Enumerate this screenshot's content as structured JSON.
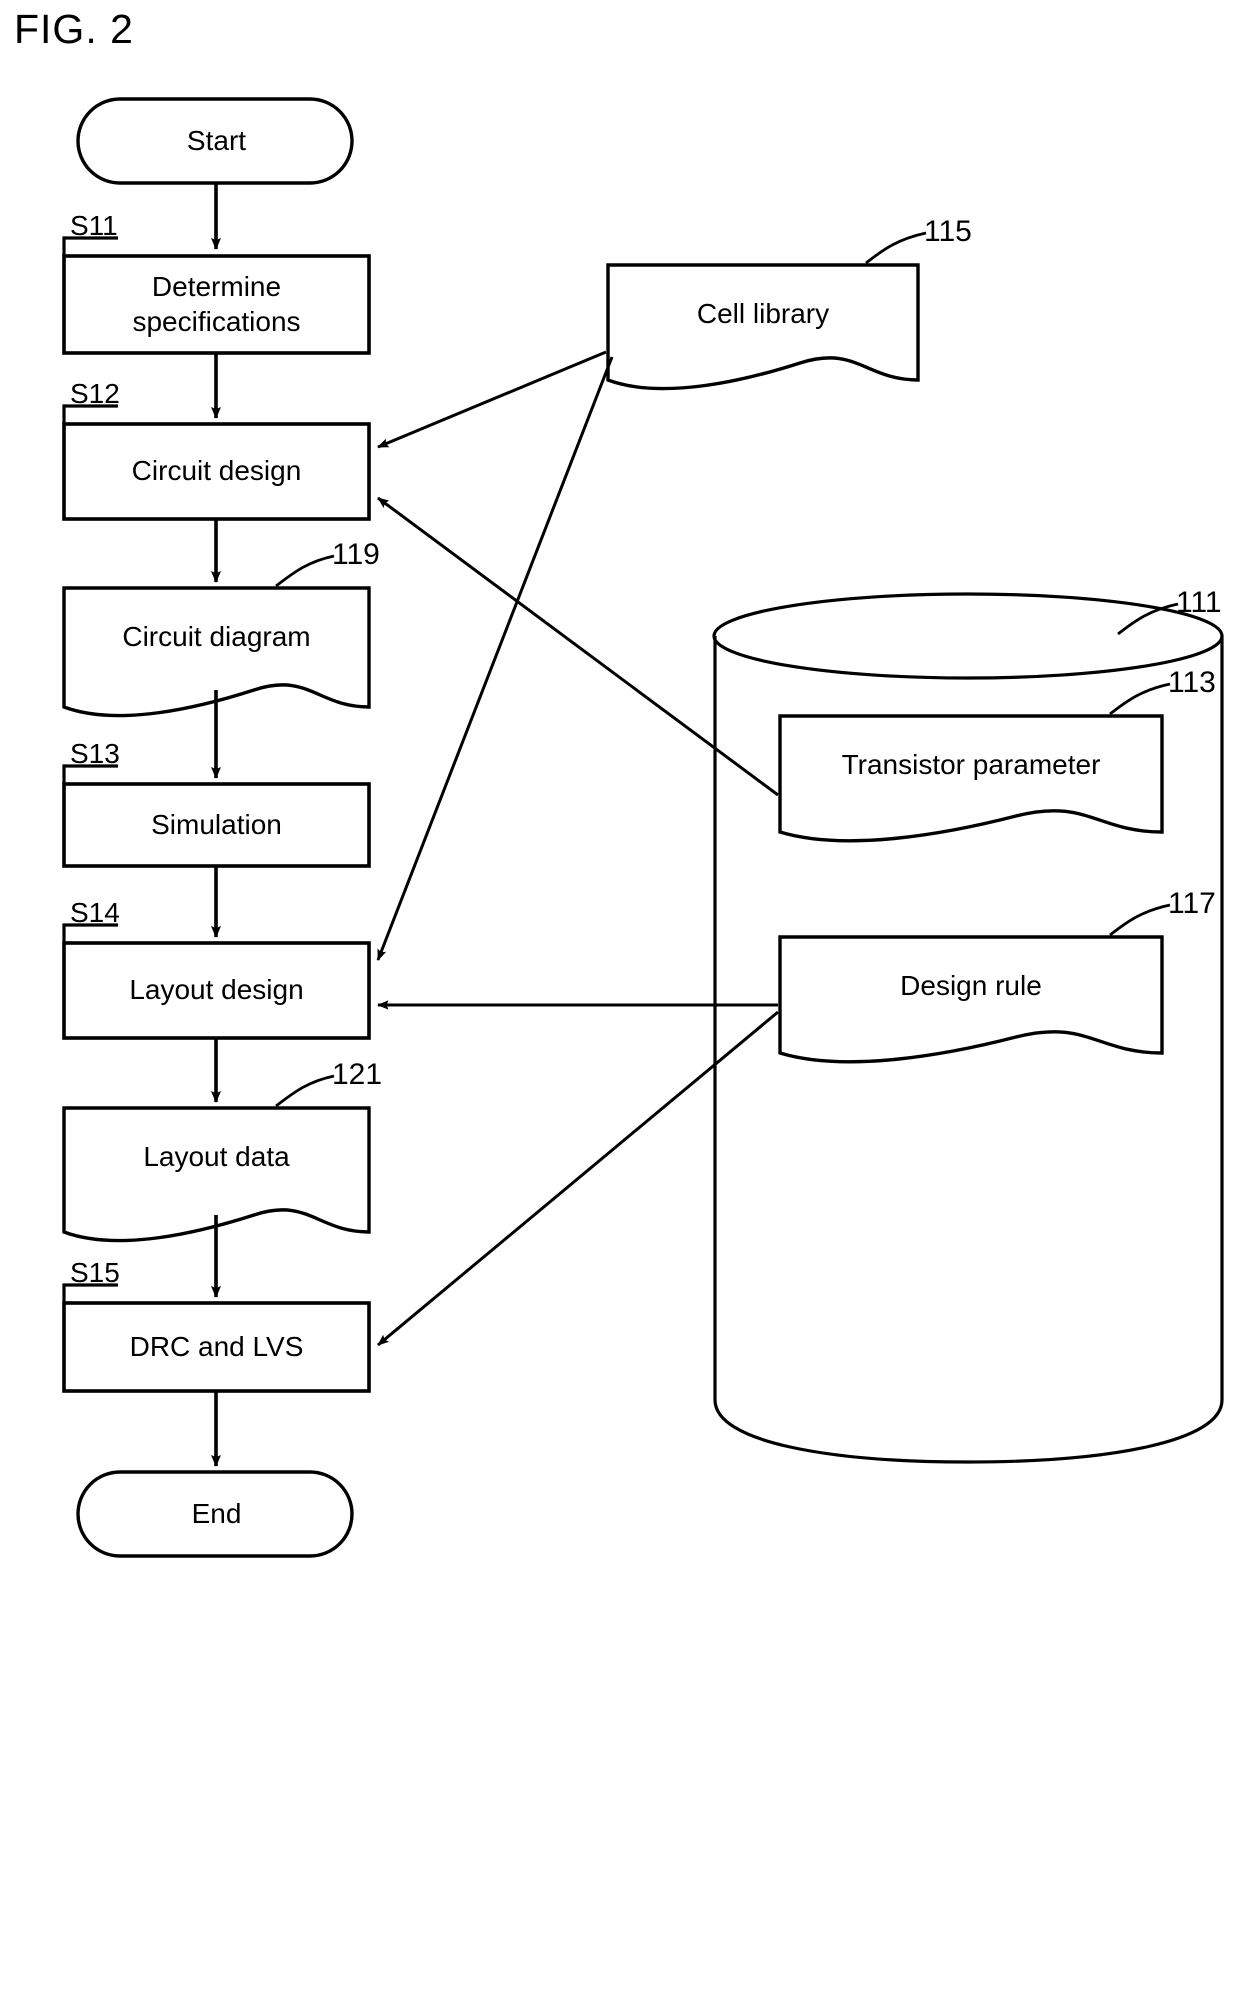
{
  "figure": {
    "label": "FIG. 2",
    "kind": "flowchart",
    "line_color": "#000000",
    "background_color": "#ffffff"
  },
  "flow": {
    "start_terminal": {
      "label": "Start",
      "shape": "stadium"
    },
    "end_terminal": {
      "label": "End",
      "shape": "stadium"
    },
    "steps": [
      {
        "tag": "S11",
        "label": "Determine\nspecifications",
        "shape": "process"
      },
      {
        "tag": "S12",
        "label": "Circuit design",
        "shape": "process"
      },
      {
        "tag": "S13",
        "label": "Simulation",
        "shape": "process"
      },
      {
        "tag": "S14",
        "label": "Layout design",
        "shape": "process"
      },
      {
        "tag": "S15",
        "label": "DRC and LVS",
        "shape": "process"
      }
    ],
    "documents": [
      {
        "ref": "119",
        "label": "Circuit diagram",
        "shape": "document"
      },
      {
        "ref": "121",
        "label": "Layout data",
        "shape": "document"
      }
    ]
  },
  "resources": {
    "cell_library": {
      "ref": "115",
      "label": "Cell library",
      "shape": "document"
    },
    "database": {
      "ref": "111",
      "label": "",
      "shape": "cylinder"
    },
    "transistor_parameter": {
      "ref": "113",
      "label": "Transistor parameter",
      "shape": "document"
    },
    "design_rule": {
      "ref": "117",
      "label": "Design rule",
      "shape": "document"
    }
  },
  "connections": [
    {
      "from": "Start",
      "to": "S11",
      "type": "arrow-down"
    },
    {
      "from": "S11",
      "to": "S12",
      "type": "arrow-down"
    },
    {
      "from": "S12",
      "to": "119",
      "type": "arrow-down"
    },
    {
      "from": "119",
      "to": "S13",
      "type": "arrow-down"
    },
    {
      "from": "S13",
      "to": "S14",
      "type": "arrow-down"
    },
    {
      "from": "S14",
      "to": "121",
      "type": "arrow-down"
    },
    {
      "from": "121",
      "to": "S15",
      "type": "arrow-down"
    },
    {
      "from": "S15",
      "to": "End",
      "type": "arrow-down"
    },
    {
      "from": "115",
      "to": "S12",
      "type": "arrow-diagonal"
    },
    {
      "from": "115",
      "to": "S14",
      "type": "arrow-diagonal"
    },
    {
      "from": "113",
      "to": "S12",
      "type": "arrow-diagonal"
    },
    {
      "from": "117",
      "to": "S14",
      "type": "arrow-left"
    },
    {
      "from": "117",
      "to": "S15",
      "type": "arrow-diagonal"
    }
  ]
}
